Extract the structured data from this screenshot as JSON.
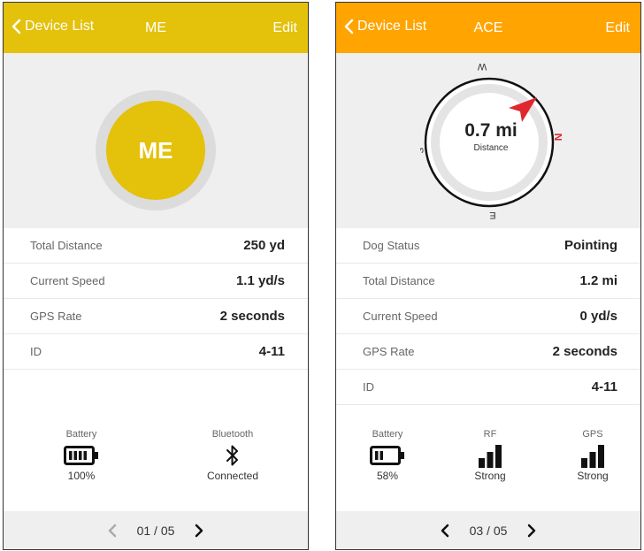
{
  "colors": {
    "me_accent": "#e4c10b",
    "ace_accent": "#ffa400",
    "compass_needle": "#e0262e"
  },
  "left": {
    "nav": {
      "back_label": "Device List",
      "title": "ME",
      "edit_label": "Edit"
    },
    "avatar_text": "ME",
    "rows": [
      {
        "label": "Total Distance",
        "value": "250 yd"
      },
      {
        "label": "Current Speed",
        "value": "1.1 yd/s"
      },
      {
        "label": "GPS Rate",
        "value": "2 seconds"
      },
      {
        "label": "ID",
        "value": "4-11"
      }
    ],
    "battery": {
      "label": "Battery",
      "value": "100%",
      "level": 1.0,
      "icon": "battery-icon"
    },
    "bluetooth": {
      "label": "Bluetooth",
      "value": "Connected",
      "icon": "bluetooth-icon"
    },
    "pager": {
      "text": "01 / 05"
    }
  },
  "right": {
    "nav": {
      "back_label": "Device List",
      "title": "ACE",
      "edit_label": "Edit"
    },
    "compass": {
      "distance": "0.7 mi",
      "distance_label": "Distance",
      "directions": {
        "N": "N",
        "S": "S",
        "E": "E",
        "W": "W"
      }
    },
    "rows": [
      {
        "label": "Dog Status",
        "value": "Pointing"
      },
      {
        "label": "Total Distance",
        "value": "1.2 mi"
      },
      {
        "label": "Current Speed",
        "value": "0 yd/s"
      },
      {
        "label": "GPS Rate",
        "value": "2 seconds"
      },
      {
        "label": "ID",
        "value": "4-11"
      }
    ],
    "battery": {
      "label": "Battery",
      "value": "58%",
      "level": 0.58,
      "icon": "battery-icon"
    },
    "rf": {
      "label": "RF",
      "value": "Strong",
      "icon": "signal-bars-icon"
    },
    "gps": {
      "label": "GPS",
      "value": "Strong",
      "icon": "signal-bars-icon"
    },
    "pager": {
      "text": "03 / 05"
    }
  }
}
